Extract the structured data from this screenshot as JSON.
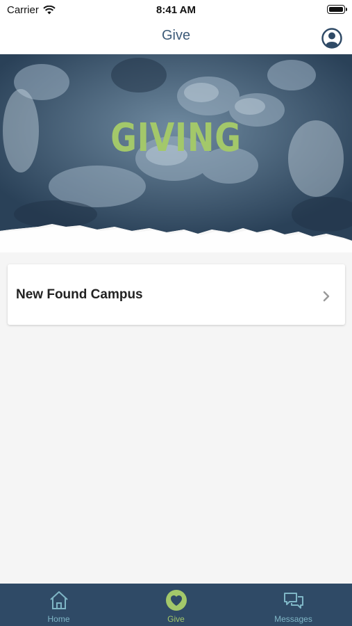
{
  "status_bar": {
    "carrier": "Carrier",
    "time": "8:41 AM"
  },
  "nav": {
    "title": "Give",
    "profile_icon": "person-circle-icon"
  },
  "hero": {
    "title": "GIVING"
  },
  "campuses": [
    {
      "name": "New Found Campus"
    }
  ],
  "tabs": [
    {
      "label": "Home",
      "icon": "home-icon"
    },
    {
      "label": "Give",
      "icon": "heart-icon",
      "active": true
    },
    {
      "label": "Messages",
      "icon": "chat-bubbles-icon"
    }
  ],
  "colors": {
    "primary": "#2f4a66",
    "accent": "#a3c86a",
    "tab_inactive": "#7fb6c6",
    "nav_title": "#3c5a78"
  }
}
